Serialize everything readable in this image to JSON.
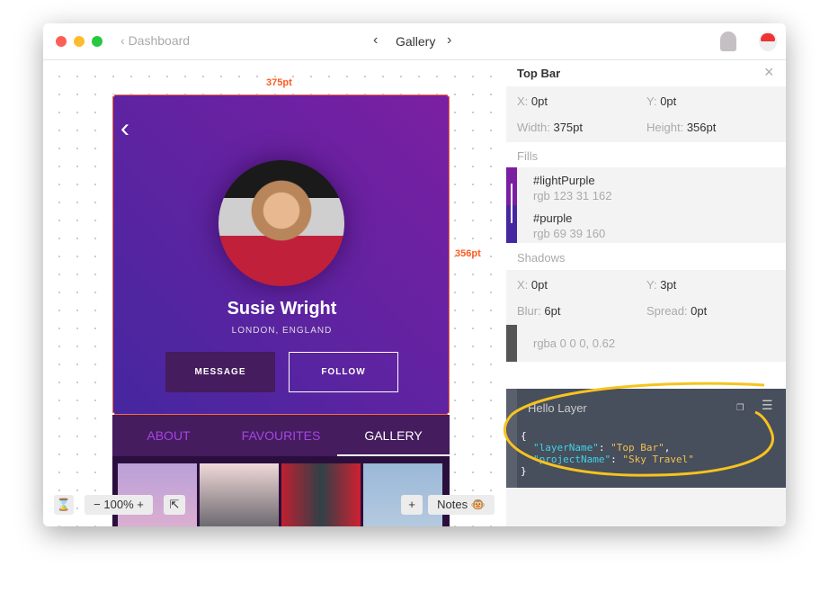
{
  "titlebar": {
    "back_label": "Dashboard",
    "title": "Gallery"
  },
  "artboard": {
    "width_label": "375pt",
    "height_label": "356pt",
    "name": "Susie Wright",
    "location": "LONDON, ENGLAND",
    "message_btn": "MESSAGE",
    "follow_btn": "FOLLOW",
    "tabs": [
      {
        "label": "ABOUT"
      },
      {
        "label": "FAVOURITES"
      },
      {
        "label": "GALLERY",
        "active": true
      }
    ]
  },
  "toolbar": {
    "zoom": "100%",
    "notes": "Notes 🐵"
  },
  "inspector": {
    "title": "Top Bar",
    "x_label": "X:",
    "x": "0pt",
    "y_label": "Y:",
    "y": "0pt",
    "w_label": "Width:",
    "w": "375pt",
    "h_label": "Height:",
    "h": "356pt",
    "fills_label": "Fills",
    "fills": [
      {
        "name": "#lightPurple",
        "rgb": "rgb 123 31 162",
        "color": "#7b1fa2"
      },
      {
        "name": "#purple",
        "rgb": "rgb 69 39 160",
        "color": "#4527a0"
      }
    ],
    "shadows_label": "Shadows",
    "sx_label": "X:",
    "sx": "0pt",
    "sy_label": "Y:",
    "sy": "3pt",
    "blur_label": "Blur:",
    "blur": "6pt",
    "spread_label": "Spread:",
    "spread": "0pt",
    "shadow_color": "rgba 0 0 0, 0.62"
  },
  "code": {
    "title": "Hello Layer",
    "open": "{",
    "k1": "\"layerName\"",
    "v1": "\"Top Bar\"",
    "k2": "\"projectName\"",
    "v2": "\"Sky Travel\"",
    "close": "}"
  },
  "colors": {
    "accent": "#ff5a1f",
    "highlight": "#f7c31e",
    "tab_inactive": "#a545e6"
  }
}
